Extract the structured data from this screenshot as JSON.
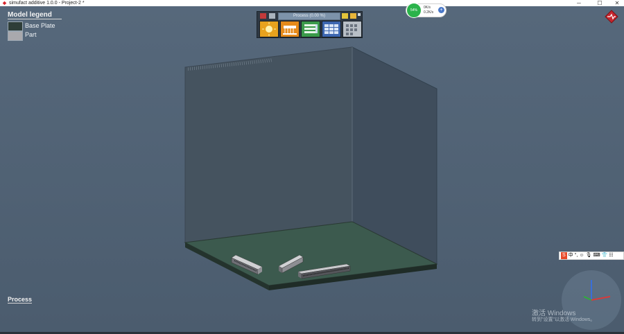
{
  "window": {
    "title": "simufact additive 1.0.0 - Project-2 *",
    "minimize_glyph": "─",
    "maximize_glyph": "☐",
    "close_glyph": "✕"
  },
  "legend": {
    "title": "Model legend",
    "items": [
      {
        "label": "Base Plate",
        "color": "#2e3d38"
      },
      {
        "label": "Part",
        "color": "#a9a9ad"
      }
    ]
  },
  "toolbar": {
    "progress_label": "Process (0.00 %)",
    "buttons": [
      {
        "name": "build-orientation-button",
        "icon": "sun-icon",
        "color": "#e8a21d"
      },
      {
        "name": "support-button",
        "icon": "support-icon",
        "color": "#e58a1a"
      },
      {
        "name": "process-parameters-button",
        "icon": "list-icon",
        "color": "#3a9a4a"
      },
      {
        "name": "results-button",
        "icon": "table-icon",
        "color": "#3c66b0"
      },
      {
        "name": "grid-button",
        "icon": "grid-icon",
        "color": "#b8bfc6"
      }
    ]
  },
  "network": {
    "percent": "54%",
    "up": "0K/s",
    "down": "0.2K/s"
  },
  "process": {
    "heading": "Process"
  },
  "build_chamber": {
    "label": "|||||||||||||||||||||||||||||||||||||||||"
  },
  "ime": {
    "items": [
      "S",
      "中",
      "°,",
      "☺",
      "🎙",
      "⌨",
      "👕",
      "☷"
    ]
  },
  "watermark": {
    "line1": "激活 Windows",
    "line2": "转到\"设置\"以激活 Windows。"
  },
  "colors": {
    "background": "#52647a",
    "plate_top": "#3e5a4f",
    "chamber": "#435161"
  }
}
